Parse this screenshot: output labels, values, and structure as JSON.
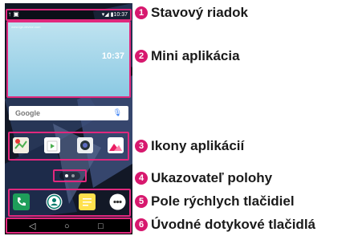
{
  "phone": {
    "status": {
      "left_icons": "↑ ▣",
      "right": "▾◢ ▮10:37"
    },
    "widget": {
      "url": "www.lge-device.com",
      "time": "10:37"
    },
    "search": {
      "label": "Google",
      "mic_icon": "microphone-icon"
    },
    "apps": [
      "maps-icon",
      "play-store-icon",
      "camera-icon",
      "gallery-icon"
    ],
    "quick": [
      "phone-icon",
      "contacts-icon",
      "messaging-icon",
      "apps-grid-icon"
    ],
    "nav": {
      "back": "◁",
      "home": "○",
      "recent": "□"
    }
  },
  "callouts": [
    {
      "num": "1",
      "text": "Stavový riadok"
    },
    {
      "num": "2",
      "text": "Mini aplikácia"
    },
    {
      "num": "3",
      "text": "Ikony aplikácií"
    },
    {
      "num": "4",
      "text": "Ukazovateľ polohy"
    },
    {
      "num": "5",
      "text": "Pole rýchlych tlačidiel"
    },
    {
      "num": "6",
      "text": "Úvodné dotykové tlačidlá"
    }
  ],
  "colors": {
    "highlight": "#e0287d",
    "badge": "#d7186e"
  }
}
